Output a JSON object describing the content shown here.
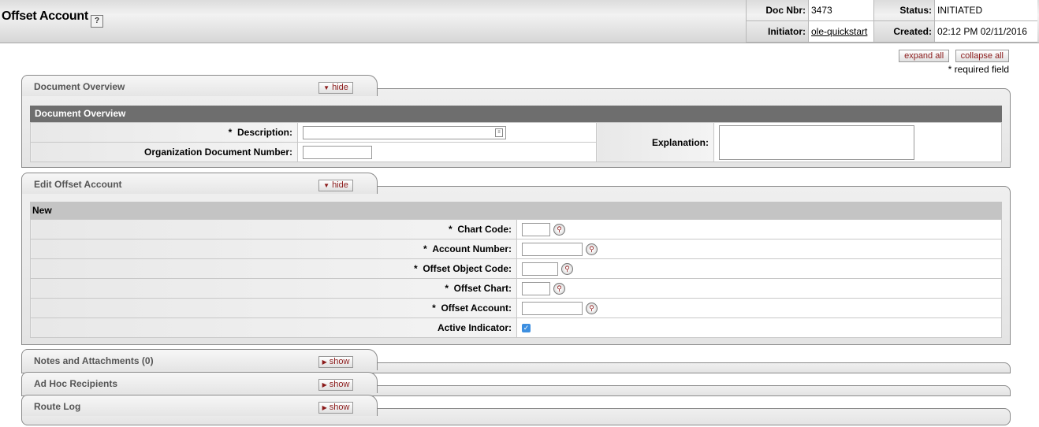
{
  "header": {
    "title": "Offset Account",
    "help_icon": "?",
    "doc_nbr_label": "Doc Nbr:",
    "doc_nbr": "3473",
    "status_label": "Status:",
    "status": "INITIATED",
    "initiator_label": "Initiator:",
    "initiator": "ole-quickstart",
    "created_label": "Created:",
    "created": "02:12 PM 02/11/2016"
  },
  "controls": {
    "expand_all": "expand all",
    "collapse_all": "collapse all",
    "required_note": "* required field"
  },
  "doc_overview": {
    "tab_title": "Document Overview",
    "toggle": "hide",
    "section_header": "Document Overview",
    "description_label": "Description:",
    "org_doc_number_label": "Organization Document Number:",
    "explanation_label": "Explanation:"
  },
  "edit_offset": {
    "tab_title": "Edit Offset Account",
    "toggle": "hide",
    "section_header": "New",
    "chart_code_label": "Chart Code:",
    "account_number_label": "Account Number:",
    "offset_object_code_label": "Offset Object Code:",
    "offset_chart_label": "Offset Chart:",
    "offset_account_label": "Offset Account:",
    "active_indicator_label": "Active Indicator:",
    "active_indicator_checked": true
  },
  "notes": {
    "tab_title": "Notes and Attachments (0)",
    "toggle": "show"
  },
  "adhoc": {
    "tab_title": "Ad Hoc Recipients",
    "toggle": "show"
  },
  "routelog": {
    "tab_title": "Route Log",
    "toggle": "show"
  },
  "required_marker": "*",
  "icons": {
    "lookup": "magnifier-icon",
    "expand": "triangle-down-icon",
    "collapse": "triangle-right-icon"
  }
}
